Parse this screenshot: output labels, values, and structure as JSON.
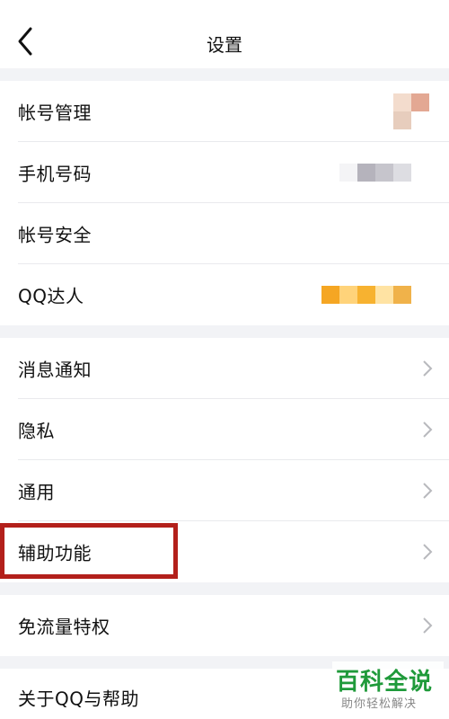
{
  "header": {
    "title": "设置",
    "back_icon": "chevron-left-icon"
  },
  "groups": [
    {
      "items": [
        {
          "label": "帐号管理",
          "value": "blurred avatar"
        },
        {
          "label": "手机号码",
          "value": "blurred number"
        },
        {
          "label": "帐号安全"
        },
        {
          "label": "QQ达人",
          "value": "blurred badge"
        }
      ]
    },
    {
      "items": [
        {
          "label": "消息通知"
        },
        {
          "label": "隐私"
        },
        {
          "label": "通用"
        },
        {
          "label": "辅助功能",
          "highlighted": true
        }
      ]
    },
    {
      "items": [
        {
          "label": "免流量特权"
        }
      ]
    },
    {
      "items": [
        {
          "label": "关于QQ与帮助"
        }
      ]
    }
  ],
  "watermark": {
    "title": "百科全说",
    "subtitle": "助你轻松解决"
  },
  "colors": {
    "highlight_border": "#b3201b",
    "watermark_green": "#1f9a3a",
    "badge_orange": "#f5a623"
  }
}
